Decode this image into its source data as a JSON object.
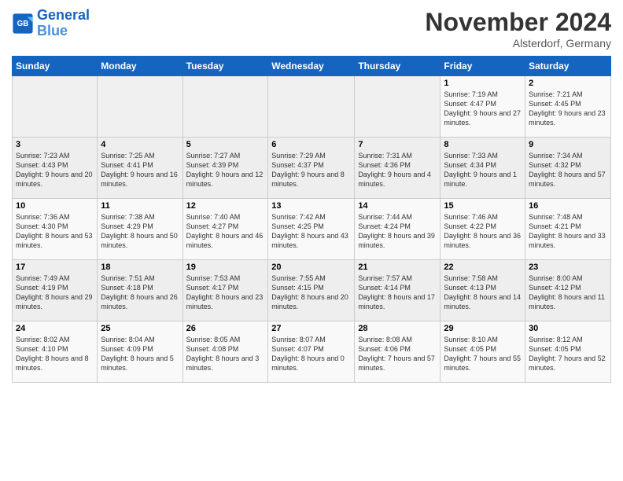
{
  "header": {
    "logo_line1": "General",
    "logo_line2": "Blue",
    "month_title": "November 2024",
    "subtitle": "Alsterdorf, Germany"
  },
  "weekdays": [
    "Sunday",
    "Monday",
    "Tuesday",
    "Wednesday",
    "Thursday",
    "Friday",
    "Saturday"
  ],
  "weeks": [
    [
      {
        "day": "",
        "info": ""
      },
      {
        "day": "",
        "info": ""
      },
      {
        "day": "",
        "info": ""
      },
      {
        "day": "",
        "info": ""
      },
      {
        "day": "",
        "info": ""
      },
      {
        "day": "1",
        "info": "Sunrise: 7:19 AM\nSunset: 4:47 PM\nDaylight: 9 hours and 27 minutes."
      },
      {
        "day": "2",
        "info": "Sunrise: 7:21 AM\nSunset: 4:45 PM\nDaylight: 9 hours and 23 minutes."
      }
    ],
    [
      {
        "day": "3",
        "info": "Sunrise: 7:23 AM\nSunset: 4:43 PM\nDaylight: 9 hours and 20 minutes."
      },
      {
        "day": "4",
        "info": "Sunrise: 7:25 AM\nSunset: 4:41 PM\nDaylight: 9 hours and 16 minutes."
      },
      {
        "day": "5",
        "info": "Sunrise: 7:27 AM\nSunset: 4:39 PM\nDaylight: 9 hours and 12 minutes."
      },
      {
        "day": "6",
        "info": "Sunrise: 7:29 AM\nSunset: 4:37 PM\nDaylight: 9 hours and 8 minutes."
      },
      {
        "day": "7",
        "info": "Sunrise: 7:31 AM\nSunset: 4:36 PM\nDaylight: 9 hours and 4 minutes."
      },
      {
        "day": "8",
        "info": "Sunrise: 7:33 AM\nSunset: 4:34 PM\nDaylight: 9 hours and 1 minute."
      },
      {
        "day": "9",
        "info": "Sunrise: 7:34 AM\nSunset: 4:32 PM\nDaylight: 8 hours and 57 minutes."
      }
    ],
    [
      {
        "day": "10",
        "info": "Sunrise: 7:36 AM\nSunset: 4:30 PM\nDaylight: 8 hours and 53 minutes."
      },
      {
        "day": "11",
        "info": "Sunrise: 7:38 AM\nSunset: 4:29 PM\nDaylight: 8 hours and 50 minutes."
      },
      {
        "day": "12",
        "info": "Sunrise: 7:40 AM\nSunset: 4:27 PM\nDaylight: 8 hours and 46 minutes."
      },
      {
        "day": "13",
        "info": "Sunrise: 7:42 AM\nSunset: 4:25 PM\nDaylight: 8 hours and 43 minutes."
      },
      {
        "day": "14",
        "info": "Sunrise: 7:44 AM\nSunset: 4:24 PM\nDaylight: 8 hours and 39 minutes."
      },
      {
        "day": "15",
        "info": "Sunrise: 7:46 AM\nSunset: 4:22 PM\nDaylight: 8 hours and 36 minutes."
      },
      {
        "day": "16",
        "info": "Sunrise: 7:48 AM\nSunset: 4:21 PM\nDaylight: 8 hours and 33 minutes."
      }
    ],
    [
      {
        "day": "17",
        "info": "Sunrise: 7:49 AM\nSunset: 4:19 PM\nDaylight: 8 hours and 29 minutes."
      },
      {
        "day": "18",
        "info": "Sunrise: 7:51 AM\nSunset: 4:18 PM\nDaylight: 8 hours and 26 minutes."
      },
      {
        "day": "19",
        "info": "Sunrise: 7:53 AM\nSunset: 4:17 PM\nDaylight: 8 hours and 23 minutes."
      },
      {
        "day": "20",
        "info": "Sunrise: 7:55 AM\nSunset: 4:15 PM\nDaylight: 8 hours and 20 minutes."
      },
      {
        "day": "21",
        "info": "Sunrise: 7:57 AM\nSunset: 4:14 PM\nDaylight: 8 hours and 17 minutes."
      },
      {
        "day": "22",
        "info": "Sunrise: 7:58 AM\nSunset: 4:13 PM\nDaylight: 8 hours and 14 minutes."
      },
      {
        "day": "23",
        "info": "Sunrise: 8:00 AM\nSunset: 4:12 PM\nDaylight: 8 hours and 11 minutes."
      }
    ],
    [
      {
        "day": "24",
        "info": "Sunrise: 8:02 AM\nSunset: 4:10 PM\nDaylight: 8 hours and 8 minutes."
      },
      {
        "day": "25",
        "info": "Sunrise: 8:04 AM\nSunset: 4:09 PM\nDaylight: 8 hours and 5 minutes."
      },
      {
        "day": "26",
        "info": "Sunrise: 8:05 AM\nSunset: 4:08 PM\nDaylight: 8 hours and 3 minutes."
      },
      {
        "day": "27",
        "info": "Sunrise: 8:07 AM\nSunset: 4:07 PM\nDaylight: 8 hours and 0 minutes."
      },
      {
        "day": "28",
        "info": "Sunrise: 8:08 AM\nSunset: 4:06 PM\nDaylight: 7 hours and 57 minutes."
      },
      {
        "day": "29",
        "info": "Sunrise: 8:10 AM\nSunset: 4:05 PM\nDaylight: 7 hours and 55 minutes."
      },
      {
        "day": "30",
        "info": "Sunrise: 8:12 AM\nSunset: 4:05 PM\nDaylight: 7 hours and 52 minutes."
      }
    ]
  ]
}
